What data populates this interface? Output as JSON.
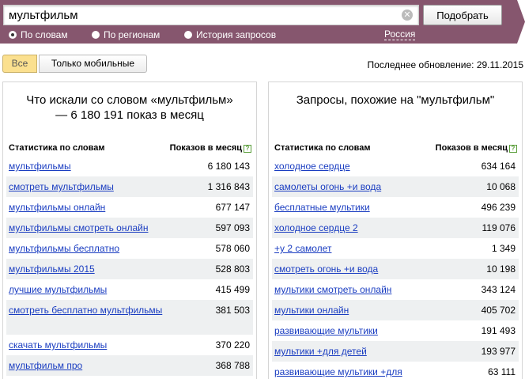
{
  "search": {
    "query": "мультфильм",
    "submit_label": "Подобрать",
    "clear_glyph": "✕"
  },
  "modes": [
    {
      "label": "По словам",
      "checked": true
    },
    {
      "label": "По регионам",
      "checked": false
    },
    {
      "label": "История запросов",
      "checked": false
    }
  ],
  "region_label": "Россия",
  "filters": {
    "all_label": "Все",
    "mobile_label": "Только мобильные"
  },
  "last_update": "Последнее обновление: 29.11.2015",
  "left_panel": {
    "title": "Что искали со словом «мультфильм» — 6 180 191 показ в месяц",
    "col_words": "Статистика по словам",
    "col_count": "Показов в месяц",
    "help_glyph": "?",
    "rows": [
      {
        "phrase": "мультфильмы",
        "count": "6 180 143"
      },
      {
        "phrase": "смотреть мультфильмы",
        "count": "1 316 843"
      },
      {
        "phrase": "мультфильмы онлайн",
        "count": "677 147"
      },
      {
        "phrase": "мультфильмы смотреть онлайн",
        "count": "597 093"
      },
      {
        "phrase": "мультфильмы бесплатно",
        "count": "578 060"
      },
      {
        "phrase": "мультфильмы 2015",
        "count": "528 803"
      },
      {
        "phrase": "лучшие мультфильмы",
        "count": "415 499"
      },
      {
        "phrase": "смотреть бесплатно мультфильмы",
        "count": "381 503"
      },
      {
        "phrase": "скачать мультфильмы",
        "count": "370 220"
      },
      {
        "phrase": "мультфильм про",
        "count": "368 788"
      }
    ]
  },
  "right_panel": {
    "title": "Запросы, похожие на \"мультфильм\"",
    "col_words": "Статистика по словам",
    "col_count": "Показов в месяц",
    "help_glyph": "?",
    "rows": [
      {
        "phrase": "холодное сердце",
        "count": "634 164"
      },
      {
        "phrase": "самолеты огонь +и вода",
        "count": "10 068"
      },
      {
        "phrase": "бесплатные мультики",
        "count": "496 239"
      },
      {
        "phrase": "холодное сердце 2",
        "count": "119 076"
      },
      {
        "phrase": "+у 2 самолет",
        "count": "1 349"
      },
      {
        "phrase": "смотреть огонь +и вода",
        "count": "10 198"
      },
      {
        "phrase": "мультики смотреть онлайн",
        "count": "343 124"
      },
      {
        "phrase": "мультики онлайн",
        "count": "405 702"
      },
      {
        "phrase": "развивающие мультики",
        "count": "191 493"
      },
      {
        "phrase": "мультики +для детей",
        "count": "193 977"
      },
      {
        "phrase": "развивающие мультики +для",
        "count": "63 111"
      }
    ]
  }
}
